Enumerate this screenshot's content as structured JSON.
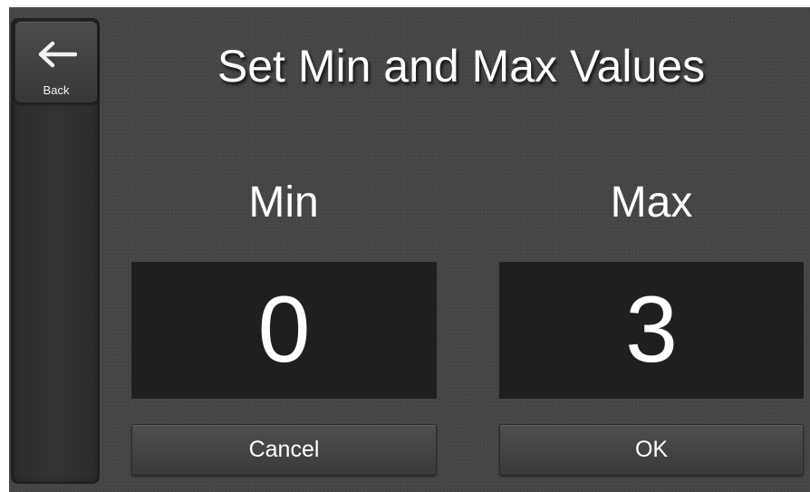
{
  "sidebar": {
    "back_icon": "left-arrow-icon",
    "back_label": "Back"
  },
  "dialog": {
    "title": "Set Min and Max Values",
    "min_label": "Min",
    "max_label": "Max",
    "min_value": "0",
    "max_value": "3",
    "cancel_label": "Cancel",
    "ok_label": "OK"
  },
  "colors": {
    "background": "#454545",
    "value_box": "#1f1f1f",
    "text": "#ffffff"
  }
}
